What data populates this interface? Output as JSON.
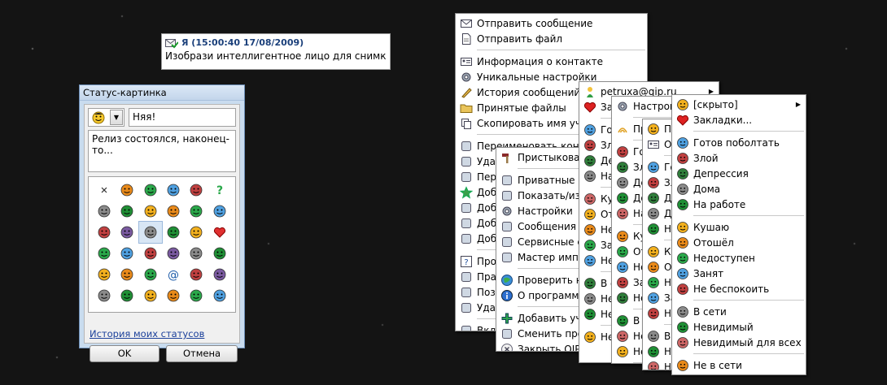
{
  "notification": {
    "header": "Я (15:00:40 17/08/2009)",
    "text": "Изобрази интеллигентное лицо для снимка..."
  },
  "status_window": {
    "title": "Статус-картинка",
    "status_title_value": "Няя!",
    "status_description": "Релиз состоялся, наконец-то...",
    "history_link": "История моих статусов",
    "ok_label": "OK",
    "cancel_label": "Отмена",
    "icons": [
      "close-x",
      "glasses",
      "person",
      "bath",
      "sewing-machine",
      "question",
      "monkey",
      "headphones",
      "video-camera",
      "sandwich",
      "syringe",
      "car",
      "duck",
      "tv",
      "smiley",
      "bed",
      "pill",
      "heart",
      "beer",
      "phone",
      "cowboy",
      "cigarette",
      "mobile-phone",
      "penguin",
      "balloons",
      "coffee",
      "joystick",
      "at-sign",
      "sick-face",
      "book",
      "beer-mug",
      "smiley-dark",
      "graduate",
      "nurse",
      "cloud-face",
      "open-book"
    ]
  },
  "menu_contact": {
    "items": [
      {
        "label": "Отправить сообщение",
        "icon": "envelope-icon"
      },
      {
        "label": "Отправить файл",
        "icon": "file-icon"
      },
      {
        "sep": true
      },
      {
        "label": "Информация о контакте",
        "icon": "card-icon"
      },
      {
        "label": "Уникальные настройки",
        "icon": "gear-icon"
      },
      {
        "label": "История сообщений",
        "icon": "history-icon"
      },
      {
        "label": "Принятые файлы",
        "icon": "folder-icon"
      },
      {
        "label": "Скопировать имя учётной записи",
        "icon": "copy-icon"
      },
      {
        "sep": true
      },
      {
        "label": "Переименовать контакт",
        "icon": "rename-icon"
      },
      {
        "label": "Удалить",
        "icon": "user-delete-icon"
      },
      {
        "label": "Перенести",
        "icon": "user-move-icon"
      },
      {
        "label": "Добавить",
        "icon": "star-icon"
      },
      {
        "label": "Добавить",
        "icon": "eye-icon"
      },
      {
        "label": "Добавить",
        "icon": "eye-red-icon"
      },
      {
        "label": "Добавить",
        "icon": "stop-icon"
      },
      {
        "sep": true
      },
      {
        "label": "Проверить",
        "icon": "question-icon"
      },
      {
        "label": "Прав",
        "icon": "rights-icon"
      },
      {
        "label": "Позвонить",
        "icon": "thumb-icon"
      },
      {
        "label": "Удалить",
        "icon": "delete-icon"
      },
      {
        "sep": true
      },
      {
        "label": "Вкл.",
        "icon": "ship-icon"
      }
    ]
  },
  "menu_main": {
    "items": [
      {
        "label": "Пристыковать",
        "icon": "hammer-icon"
      },
      {
        "sep": true
      },
      {
        "label": "Приватные списки",
        "icon": "list-icon"
      },
      {
        "label": "Показать/изменить",
        "icon": "window-icon"
      },
      {
        "label": "Настройки",
        "icon": "gear-icon"
      },
      {
        "label": "Сообщения автоответа",
        "icon": "chat-icon"
      },
      {
        "label": "Сервисные сообщения",
        "icon": "service-icon"
      },
      {
        "label": "Мастер импорта",
        "icon": "wizard-icon"
      },
      {
        "sep": true
      },
      {
        "label": "Проверить наличие обновлений",
        "icon": "globe-icon"
      },
      {
        "label": "О программе",
        "icon": "info-icon"
      },
      {
        "sep": true
      },
      {
        "label": "Добавить учётную запись",
        "icon": "plus-icon"
      },
      {
        "label": "Сменить профиль",
        "icon": "profile-icon"
      },
      {
        "label": "Закрыть QIP",
        "icon": "close-icon"
      }
    ]
  },
  "menu_account": {
    "items": [
      {
        "label": "petruxa@qip.ru",
        "icon": "flower-icon",
        "submenu": true
      },
      {
        "label": "Закладки...",
        "icon": "heart-icon"
      },
      {
        "sep": true
      },
      {
        "label": "Готов поболтать",
        "icon": "status-icon"
      },
      {
        "label": "Злой",
        "icon": "status-icon"
      },
      {
        "label": "Депрессия",
        "icon": "status-icon"
      },
      {
        "label": "На работе",
        "icon": "status-icon"
      },
      {
        "sep": true
      },
      {
        "label": "Кушаю",
        "icon": "status-icon"
      },
      {
        "label": "Отошёл",
        "icon": "status-icon"
      },
      {
        "label": "Недоступен",
        "icon": "status-icon"
      },
      {
        "label": "Занят",
        "icon": "status-icon"
      },
      {
        "label": "Не беспокоить",
        "icon": "status-icon"
      },
      {
        "sep": true
      },
      {
        "label": "В сети",
        "icon": "status-icon"
      },
      {
        "label": "Невидимый",
        "icon": "status-icon"
      },
      {
        "label": "Невидимый для всех",
        "icon": "status-icon"
      },
      {
        "sep": true
      },
      {
        "label": "Не в сети",
        "icon": "status-icon"
      }
    ]
  },
  "menu_sub1": {
    "items": [
      {
        "label": "Настройки",
        "icon": "gear-icon"
      },
      {
        "sep": true
      },
      {
        "label": "Приоритет",
        "icon": "signal-icon"
      },
      {
        "sep": true
      },
      {
        "label": "Готов",
        "icon": "status-icon"
      },
      {
        "label": "Злой",
        "icon": "status-icon"
      },
      {
        "label": "Депрессия",
        "icon": "status-icon"
      },
      {
        "label": "Дома",
        "icon": "status-icon"
      },
      {
        "label": "На работе",
        "icon": "status-icon"
      },
      {
        "sep": true
      },
      {
        "label": "Кушаю",
        "icon": "status-icon"
      },
      {
        "label": "Отошёл",
        "icon": "status-icon"
      },
      {
        "label": "Недоступен",
        "icon": "status-icon"
      },
      {
        "label": "Занят",
        "icon": "status-icon"
      },
      {
        "label": "Не беспокоить",
        "icon": "status-icon"
      },
      {
        "sep": true
      },
      {
        "label": "В сети",
        "icon": "status-icon"
      },
      {
        "label": "Невидимый",
        "icon": "status-icon"
      },
      {
        "label": "Невидимый для всех",
        "icon": "status-icon"
      },
      {
        "sep": true
      },
      {
        "label": "Не в сети",
        "icon": "status-icon"
      }
    ]
  },
  "menu_sub2": {
    "items": [
      {
        "label": "Пр",
        "icon": "status-icon"
      },
      {
        "label": "От",
        "icon": "card-icon"
      },
      {
        "sep": true
      },
      {
        "label": "Го",
        "icon": "status-icon"
      },
      {
        "label": "Зл",
        "icon": "status-icon"
      },
      {
        "label": "Де",
        "icon": "status-icon"
      },
      {
        "label": "До",
        "icon": "status-icon"
      },
      {
        "label": "На",
        "icon": "status-icon"
      },
      {
        "sep": true
      },
      {
        "label": "Ку",
        "icon": "status-icon"
      },
      {
        "label": "От",
        "icon": "status-icon"
      },
      {
        "label": "Не",
        "icon": "status-icon"
      },
      {
        "label": "За",
        "icon": "status-icon"
      },
      {
        "label": "Не",
        "icon": "status-icon"
      },
      {
        "sep": true
      },
      {
        "label": "В",
        "icon": "status-icon"
      },
      {
        "label": "Не",
        "icon": "status-icon"
      },
      {
        "label": "Не",
        "icon": "status-icon"
      },
      {
        "sep": true
      },
      {
        "label": "Не",
        "icon": "status-icon"
      }
    ]
  },
  "menu_status": {
    "items": [
      {
        "label": "[скрыто]",
        "icon": "status-icon",
        "submenu": true
      },
      {
        "label": "Закладки...",
        "icon": "heart-icon"
      },
      {
        "sep": true
      },
      {
        "label": "Готов поболтать",
        "icon": "status-icon"
      },
      {
        "label": "Злой",
        "icon": "status-icon"
      },
      {
        "label": "Депрессия",
        "icon": "status-icon"
      },
      {
        "label": "Дома",
        "icon": "status-icon"
      },
      {
        "label": "На работе",
        "icon": "status-icon"
      },
      {
        "sep": true
      },
      {
        "label": "Кушаю",
        "icon": "status-icon"
      },
      {
        "label": "Отошёл",
        "icon": "status-icon"
      },
      {
        "label": "Недоступен",
        "icon": "status-icon"
      },
      {
        "label": "Занят",
        "icon": "status-icon"
      },
      {
        "label": "Не беспокоить",
        "icon": "status-icon"
      },
      {
        "sep": true
      },
      {
        "label": "В сети",
        "icon": "status-icon"
      },
      {
        "label": "Невидимый",
        "icon": "status-icon"
      },
      {
        "label": "Невидимый для всех",
        "icon": "status-icon"
      },
      {
        "sep": true
      },
      {
        "label": "Не в сети",
        "icon": "status-icon"
      }
    ]
  }
}
